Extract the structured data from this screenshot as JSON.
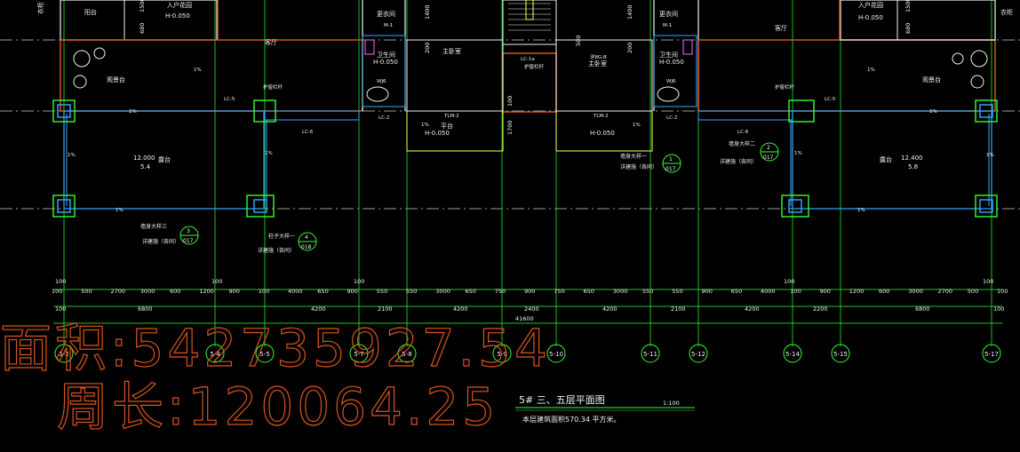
{
  "drawing": {
    "title": "5# 三、五层平面图",
    "scale": "1:100",
    "note": "本层建筑面积570.34 平方米。",
    "area_label": "面积:542735927.54",
    "perimeter_label": "周长:120064.25"
  },
  "rooms": [
    {
      "key": "r1",
      "label": "客厅"
    },
    {
      "key": "r2",
      "label": "客厅"
    },
    {
      "key": "r3",
      "label": "主卧室"
    },
    {
      "key": "r4",
      "label": "主卧室"
    },
    {
      "key": "r5",
      "label": "观景台"
    },
    {
      "key": "r6",
      "label": "观景台"
    },
    {
      "key": "r7",
      "label": "平台"
    },
    {
      "key": "r8",
      "label": "露台"
    },
    {
      "key": "r9",
      "label": "卫生间"
    },
    {
      "key": "r10",
      "label": "卫生间"
    },
    {
      "key": "r11",
      "label": "更衣间"
    },
    {
      "key": "r12",
      "label": "更衣间"
    },
    {
      "key": "r13",
      "label": "入户花园"
    },
    {
      "key": "r14",
      "label": "入户花园"
    },
    {
      "key": "r15",
      "label": "衣柜"
    },
    {
      "key": "r16",
      "label": "衣柜"
    },
    {
      "key": "r17",
      "label": "阳台"
    }
  ],
  "levels": [
    {
      "key": "l1",
      "label": "H-0.050"
    },
    {
      "key": "l2",
      "label": "H-0.050"
    },
    {
      "key": "l3",
      "label": "H-0.050"
    },
    {
      "key": "l4",
      "label": "H-0.050"
    },
    {
      "key": "l5",
      "label": "H-0.050"
    },
    {
      "key": "l6",
      "label": "H-0.050"
    },
    {
      "key": "l7",
      "label": "12.000"
    },
    {
      "key": "l8",
      "label": "5.4"
    },
    {
      "key": "l9",
      "label": "12.400"
    },
    {
      "key": "l10",
      "label": "5.8"
    }
  ],
  "tags": [
    {
      "key": "t1",
      "label": "LC-5"
    },
    {
      "key": "t2",
      "label": "LC-5"
    },
    {
      "key": "t3",
      "label": "LC-6"
    },
    {
      "key": "t4",
      "label": "LC-6"
    },
    {
      "key": "t5",
      "label": "LC-2"
    },
    {
      "key": "t6",
      "label": "LC-2"
    },
    {
      "key": "t7",
      "label": "TLM-2"
    },
    {
      "key": "t8",
      "label": "TLM-2"
    },
    {
      "key": "t9",
      "label": "LC-1a"
    },
    {
      "key": "t10",
      "label": "M-1"
    },
    {
      "key": "t11",
      "label": "M-1"
    },
    {
      "key": "t12",
      "label": "WJ6"
    },
    {
      "key": "t13",
      "label": "WJ6"
    },
    {
      "key": "t14",
      "label": "护窗栏杆"
    },
    {
      "key": "t15",
      "label": "护窗栏杆"
    },
    {
      "key": "t16",
      "label": "护窗栏杆"
    },
    {
      "key": "t17",
      "label": "详8G-B"
    }
  ],
  "slopes": [
    "1%",
    "1%",
    "1%",
    "1%",
    "1%",
    "1%",
    "1%",
    "1%",
    "1%",
    "1%",
    "1%",
    "1%"
  ],
  "callouts": [
    {
      "key": "c1",
      "text": "墙身大样一",
      "sub": "详建施（各同）",
      "num": "1",
      "sheet": "017"
    },
    {
      "key": "c2",
      "text": "墙身大样二",
      "sub": "详建施（各同）",
      "num": "2",
      "sheet": "017"
    },
    {
      "key": "c3",
      "text": "墙身大样三",
      "sub": "详建施（各同）",
      "num": "3",
      "sheet": "017"
    },
    {
      "key": "c4",
      "text": "柱子大样一",
      "sub": "详建施（各同）",
      "num": "4",
      "sheet": "018"
    }
  ],
  "vertical_dims": [
    "1500",
    "680",
    "1400",
    "200",
    "500",
    "200",
    "1400",
    "1500",
    "680",
    "200",
    "1200",
    "100"
  ],
  "dim_row1": [
    "100",
    "500",
    "2700",
    "3000",
    "600",
    "1200",
    "900",
    "100",
    "4000",
    "650",
    "900",
    "550",
    "550",
    "3000",
    "650",
    "750",
    "900",
    "750",
    "650",
    "3000",
    "550",
    "550",
    "900",
    "650",
    "4000",
    "100",
    "900",
    "1200",
    "600",
    "3000",
    "2700",
    "500",
    "100"
  ],
  "dim_row1_top": [
    "100",
    "100",
    "100",
    "100",
    "100"
  ],
  "dim_row2": [
    "100",
    "6800",
    "4200",
    "2100",
    "4200",
    "2400",
    "4200",
    "2100",
    "4200",
    "2200",
    "6800",
    "100"
  ],
  "dim_row3": [
    "41600"
  ],
  "axes": [
    "5-2",
    "5-4",
    "5-5",
    "5-7",
    "5-8",
    "5-9",
    "5-10",
    "5-11",
    "5-12",
    "5-14",
    "5-15",
    "5-17"
  ],
  "stair_dims": [
    "100",
    "1700"
  ]
}
